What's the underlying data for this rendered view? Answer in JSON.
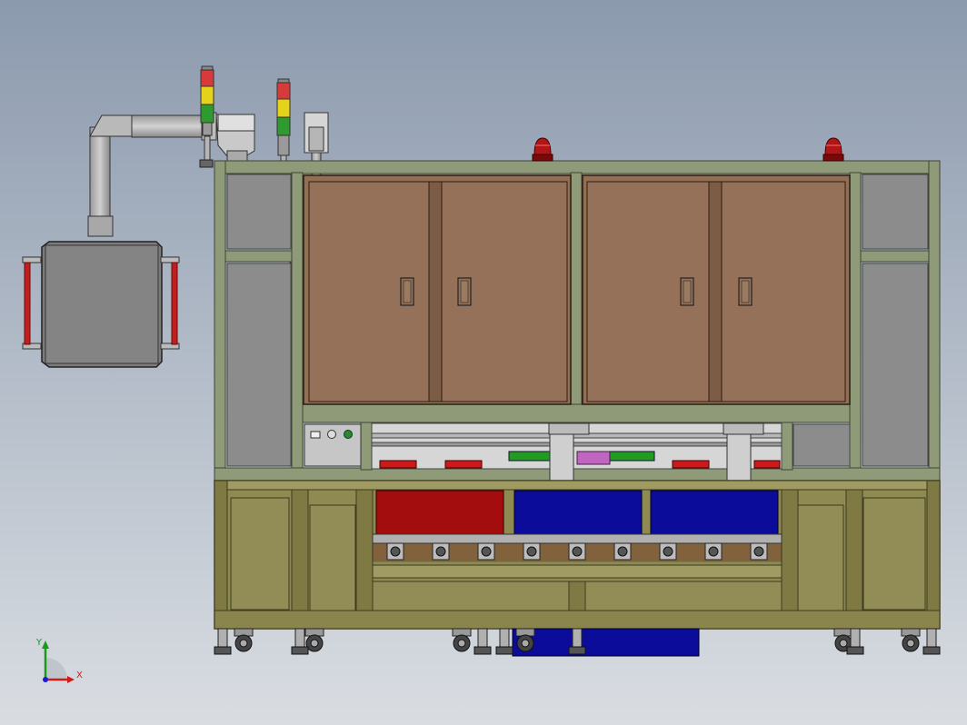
{
  "viewport": {
    "background_top": "#8c9aae",
    "background_bottom": "#d9dde2"
  },
  "colors": {
    "frame": "#8f9b78",
    "frame_dark": "#5c6650",
    "panel_grey": "#8c8c8c",
    "door_brown": "#926e52",
    "base_olive": "#8f8a52",
    "base_olive_dark": "#6b673b",
    "tray_red": "#a30d0d",
    "tray_blue": "#0b0d9a",
    "beacon_red": "#b01616",
    "light_red": "#d83a3a",
    "light_yellow": "#e5d21a",
    "light_green": "#2f9a2f",
    "cabinet_grey": "#7c7c7c",
    "fan_black": "#2a2a2a",
    "x_axis": "#d11b1b",
    "y_axis": "#1a9a1a",
    "z_axis": "#1b1bd1"
  },
  "triad": {
    "x_label": "X",
    "y_label": "Y"
  },
  "icons": {
    "left_beacon": "signal-tower-icon",
    "right_beacon": "signal-tower-icon",
    "roof_lamp": "warning-lamp-icon",
    "control_buttons": "push-button-icon"
  }
}
